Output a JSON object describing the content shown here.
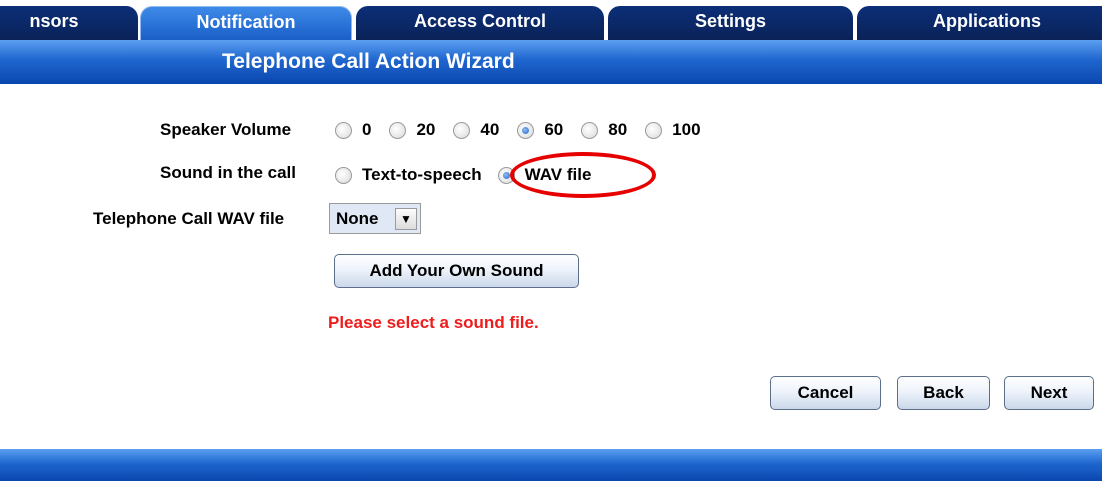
{
  "tabs": [
    {
      "label": "nsors",
      "active": false
    },
    {
      "label": "Notification",
      "active": true
    },
    {
      "label": "Access Control",
      "active": false
    },
    {
      "label": "Settings",
      "active": false
    },
    {
      "label": "Applications",
      "active": false
    }
  ],
  "wizard": {
    "title": "Telephone Call Action Wizard"
  },
  "speaker_volume": {
    "label": "Speaker Volume",
    "options": [
      "0",
      "20",
      "40",
      "60",
      "80",
      "100"
    ],
    "selected": "60"
  },
  "sound_in_call": {
    "label": "Sound in the call",
    "options": [
      "Text-to-speech",
      "WAV file"
    ],
    "selected": "WAV file"
  },
  "wav_file": {
    "label": "Telephone Call WAV file",
    "value": "None",
    "arrow_icon": "chevron-down-icon"
  },
  "add_sound_button": "Add Your Own Sound",
  "error_message": "Please select a sound file.",
  "buttons": {
    "cancel": "Cancel",
    "back": "Back",
    "next": "Next"
  },
  "colors": {
    "accent": "#1f66cf",
    "tab_dark": "#0c2f78",
    "error": "#ee1c1c",
    "highlight": "#e60000"
  }
}
